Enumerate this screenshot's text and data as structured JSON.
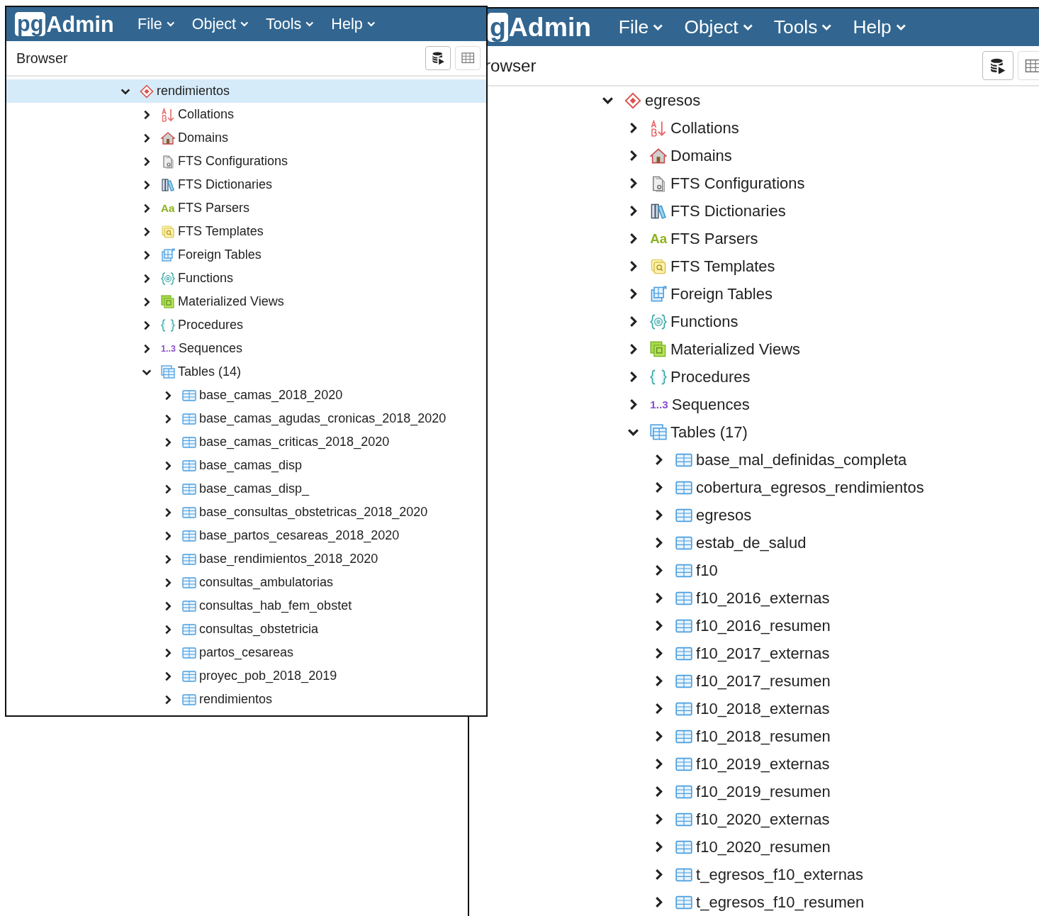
{
  "windows": [
    {
      "logo": {
        "mark": "pg",
        "word": "Admin"
      },
      "menu": [
        "File",
        "Object",
        "Tools",
        "Help"
      ],
      "panel_title": "Browser",
      "tree": [
        {
          "label": "rendimientos",
          "kind": "database",
          "expanded": true,
          "selected": true,
          "children": [
            {
              "label": "Collations",
              "kind": "collations",
              "expanded": false,
              "selected": false
            },
            {
              "label": "Domains",
              "kind": "domains",
              "expanded": false,
              "selected": false
            },
            {
              "label": "FTS Configurations",
              "kind": "fts_config",
              "expanded": false,
              "selected": false
            },
            {
              "label": "FTS Dictionaries",
              "kind": "fts_dict",
              "expanded": false,
              "selected": false
            },
            {
              "label": "FTS Parsers",
              "kind": "fts_parsers",
              "glyph": "Aa",
              "expanded": false,
              "selected": false
            },
            {
              "label": "FTS Templates",
              "kind": "fts_templates",
              "expanded": false,
              "selected": false
            },
            {
              "label": "Foreign Tables",
              "kind": "foreign_tables",
              "expanded": false,
              "selected": false
            },
            {
              "label": "Functions",
              "kind": "functions",
              "expanded": false,
              "selected": false
            },
            {
              "label": "Materialized Views",
              "kind": "matviews",
              "expanded": false,
              "selected": false
            },
            {
              "label": "Procedures",
              "kind": "procedures",
              "expanded": false,
              "selected": false
            },
            {
              "label": "Sequences",
              "kind": "sequences",
              "glyph": "1..3",
              "expanded": false,
              "selected": false
            },
            {
              "label": "Tables (14)",
              "kind": "tables",
              "expanded": true,
              "selected": false,
              "children": [
                {
                  "label": "base_camas_2018_2020",
                  "kind": "table",
                  "expanded": false,
                  "selected": false
                },
                {
                  "label": "base_camas_agudas_cronicas_2018_2020",
                  "kind": "table",
                  "expanded": false,
                  "selected": false
                },
                {
                  "label": "base_camas_criticas_2018_2020",
                  "kind": "table",
                  "expanded": false,
                  "selected": false
                },
                {
                  "label": "base_camas_disp",
                  "kind": "table",
                  "expanded": false,
                  "selected": false
                },
                {
                  "label": "base_camas_disp_",
                  "kind": "table",
                  "expanded": false,
                  "selected": false
                },
                {
                  "label": "base_consultas_obstetricas_2018_2020",
                  "kind": "table",
                  "expanded": false,
                  "selected": false
                },
                {
                  "label": "base_partos_cesareas_2018_2020",
                  "kind": "table",
                  "expanded": false,
                  "selected": false
                },
                {
                  "label": "base_rendimientos_2018_2020",
                  "kind": "table",
                  "expanded": false,
                  "selected": false
                },
                {
                  "label": "consultas_ambulatorias",
                  "kind": "table",
                  "expanded": false,
                  "selected": false
                },
                {
                  "label": "consultas_hab_fem_obstet",
                  "kind": "table",
                  "expanded": false,
                  "selected": false
                },
                {
                  "label": "consultas_obstetricia",
                  "kind": "table",
                  "expanded": false,
                  "selected": false
                },
                {
                  "label": "partos_cesareas",
                  "kind": "table",
                  "expanded": false,
                  "selected": false
                },
                {
                  "label": "proyec_pob_2018_2019",
                  "kind": "table",
                  "expanded": false,
                  "selected": false
                },
                {
                  "label": "rendimientos",
                  "kind": "table",
                  "expanded": false,
                  "selected": false
                }
              ]
            }
          ]
        }
      ]
    },
    {
      "logo": {
        "mark": "g",
        "word": "Admin"
      },
      "menu": [
        "File",
        "Object",
        "Tools",
        "Help"
      ],
      "panel_title": "rowser",
      "tree": [
        {
          "label": "egresos",
          "kind": "database",
          "expanded": true,
          "selected": false,
          "children": [
            {
              "label": "Collations",
              "kind": "collations",
              "expanded": false,
              "selected": false
            },
            {
              "label": "Domains",
              "kind": "domains",
              "expanded": false,
              "selected": false
            },
            {
              "label": "FTS Configurations",
              "kind": "fts_config",
              "expanded": false,
              "selected": false
            },
            {
              "label": "FTS Dictionaries",
              "kind": "fts_dict",
              "expanded": false,
              "selected": false
            },
            {
              "label": "FTS Parsers",
              "kind": "fts_parsers",
              "glyph": "Aa",
              "expanded": false,
              "selected": false
            },
            {
              "label": "FTS Templates",
              "kind": "fts_templates",
              "expanded": false,
              "selected": false
            },
            {
              "label": "Foreign Tables",
              "kind": "foreign_tables",
              "expanded": false,
              "selected": false
            },
            {
              "label": "Functions",
              "kind": "functions",
              "expanded": false,
              "selected": false
            },
            {
              "label": "Materialized Views",
              "kind": "matviews",
              "expanded": false,
              "selected": false
            },
            {
              "label": "Procedures",
              "kind": "procedures",
              "expanded": false,
              "selected": false
            },
            {
              "label": "Sequences",
              "kind": "sequences",
              "glyph": "1..3",
              "expanded": false,
              "selected": false
            },
            {
              "label": "Tables (17)",
              "kind": "tables",
              "expanded": true,
              "selected": false,
              "children": [
                {
                  "label": "base_mal_definidas_completa",
                  "kind": "table",
                  "expanded": false,
                  "selected": false
                },
                {
                  "label": "cobertura_egresos_rendimientos",
                  "kind": "table",
                  "expanded": false,
                  "selected": false
                },
                {
                  "label": "egresos",
                  "kind": "table",
                  "expanded": false,
                  "selected": false
                },
                {
                  "label": "estab_de_salud",
                  "kind": "table",
                  "expanded": false,
                  "selected": false
                },
                {
                  "label": "f10",
                  "kind": "table",
                  "expanded": false,
                  "selected": false
                },
                {
                  "label": "f10_2016_externas",
                  "kind": "table",
                  "expanded": false,
                  "selected": false
                },
                {
                  "label": "f10_2016_resumen",
                  "kind": "table",
                  "expanded": false,
                  "selected": false
                },
                {
                  "label": "f10_2017_externas",
                  "kind": "table",
                  "expanded": false,
                  "selected": false
                },
                {
                  "label": "f10_2017_resumen",
                  "kind": "table",
                  "expanded": false,
                  "selected": false
                },
                {
                  "label": "f10_2018_externas",
                  "kind": "table",
                  "expanded": false,
                  "selected": false
                },
                {
                  "label": "f10_2018_resumen",
                  "kind": "table",
                  "expanded": false,
                  "selected": false
                },
                {
                  "label": "f10_2019_externas",
                  "kind": "table",
                  "expanded": false,
                  "selected": false
                },
                {
                  "label": "f10_2019_resumen",
                  "kind": "table",
                  "expanded": false,
                  "selected": false
                },
                {
                  "label": "f10_2020_externas",
                  "kind": "table",
                  "expanded": false,
                  "selected": false
                },
                {
                  "label": "f10_2020_resumen",
                  "kind": "table",
                  "expanded": false,
                  "selected": false
                },
                {
                  "label": "t_egresos_f10_externas",
                  "kind": "table",
                  "expanded": false,
                  "selected": false
                },
                {
                  "label": "t_egresos_f10_resumen",
                  "kind": "table",
                  "expanded": false,
                  "selected": false
                }
              ]
            }
          ]
        }
      ]
    }
  ]
}
